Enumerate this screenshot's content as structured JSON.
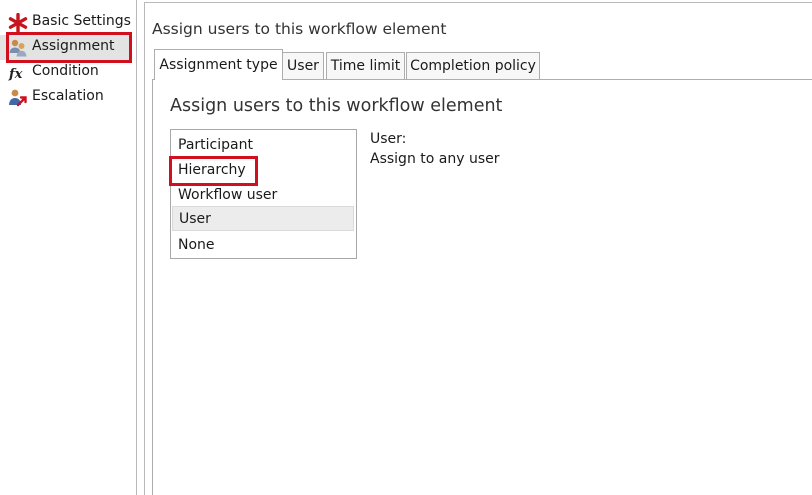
{
  "nav": {
    "items": [
      {
        "label": "Basic Settings",
        "icon": "asterisk-icon"
      },
      {
        "label": "Assignment",
        "icon": "assign-users-icon"
      },
      {
        "label": "Condition",
        "icon": "function-icon"
      },
      {
        "label": "Escalation",
        "icon": "escalation-icon"
      }
    ],
    "selected": "Assignment"
  },
  "header": {
    "title": "Assign users to this workflow element"
  },
  "tabs": [
    {
      "label": "Assignment type",
      "active": true
    },
    {
      "label": "User",
      "active": false
    },
    {
      "label": "Time limit",
      "active": false
    },
    {
      "label": "Completion policy",
      "active": false
    }
  ],
  "panel": {
    "title": "Assign users to this workflow element",
    "options": [
      "Participant",
      "Hierarchy",
      "Workflow user",
      "User",
      "None"
    ],
    "selected_option": "User",
    "detail_label": "User:",
    "detail_value": "Assign to any user"
  },
  "colors": {
    "highlight": "#d0101e",
    "border": "#adadad",
    "selected_bg": "#ececec"
  }
}
